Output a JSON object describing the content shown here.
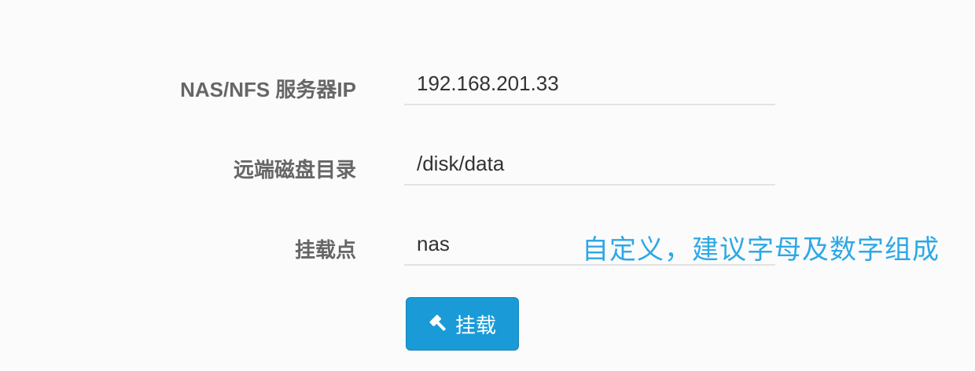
{
  "form": {
    "rows": [
      {
        "label": "NAS/NFS 服务器IP",
        "value": "192.168.201.33"
      },
      {
        "label": "远端磁盘目录",
        "value": "/disk/data"
      },
      {
        "label": "挂载点",
        "value": "nas",
        "hint": "自定义，建议字母及数字组成"
      }
    ],
    "submit": {
      "label": "挂载",
      "icon": "gavel-icon"
    }
  },
  "colors": {
    "accent": "#1a9bd7",
    "hint": "#2ea8e6",
    "label": "#666666",
    "value": "#333333",
    "underline": "#e3e3e3",
    "background": "#fbfbfb"
  }
}
